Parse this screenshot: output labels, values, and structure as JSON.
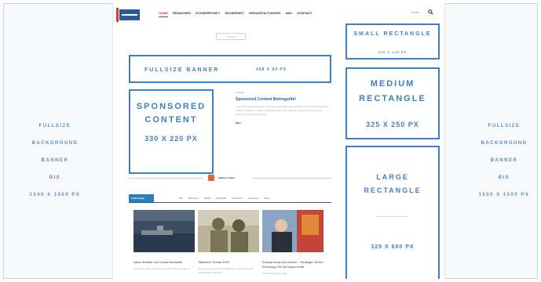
{
  "background": {
    "left_lines": [
      "Fullsize",
      "Background",
      "Banner",
      "bis",
      "1500 x 1500 px"
    ],
    "right_lines": [
      "Fullsize",
      "Background",
      "Banner",
      "bis",
      "1500 x 1500 px"
    ]
  },
  "nav": {
    "items": [
      "Home",
      "Branchen",
      "Schwerpunkt",
      "Sicherheit",
      "Veranstaltungen",
      "Abo",
      "Kontakt"
    ],
    "search_placeholder": "Suche"
  },
  "small_pill": "Anzeige",
  "ads": {
    "fullsize": {
      "title": "Fullsize Banner",
      "size": "468 x 60 px"
    },
    "sponsored": {
      "title": "Sponsored Content",
      "size": "330 x 220 px"
    },
    "small_rect": {
      "title": "Small Rectangle",
      "size": "325 x 125 px"
    },
    "medium_rect": {
      "title": "Medium Rectangle",
      "size": "325 x 250 px"
    },
    "large_rect": {
      "title": "Large Rectangle",
      "size": "325 x 600 px"
    }
  },
  "article": {
    "kicker": "Anzeige",
    "title": "Sponsored Content Beitragstitel",
    "text": "Lorem ipsum dolor sit amet, consetetur sadipscing elitr, sed diam nonumy eirmod tempor invidunt ut labore et dolore magna aliquyam erat, sed diam voluptua. At vero eos et accusam et justo duo dolores.",
    "more": "Mehr"
  },
  "section": {
    "title": "Weitere Artikel"
  },
  "tabs": {
    "active": "Topbeiträge",
    "items": [
      "Alle",
      "Branchen",
      "Politik",
      "Wirtschaft",
      "Sicherheit",
      "Interviews",
      "News"
    ]
  },
  "cards": [
    {
      "title": "Neue Struktur von Cobra Netzwerk",
      "text": "Nisi tempor dolor sit amet, sed diam invidunt ut labore."
    },
    {
      "title": "Taktische Trends 2019",
      "text": "Neue Ausrüstung für Spezialkräfte, Innovationen und Technologie im Einsatz."
    },
    {
      "title": "Europa muss sich rüsten – Strategie mit der Erhöhung 2% der Nation Kraft",
      "text": "Mehr Investitionen nötig."
    }
  ],
  "colors": {
    "accent": "#3d7fc1",
    "nav_active": "#d8362b",
    "rss": "#e0653a"
  }
}
